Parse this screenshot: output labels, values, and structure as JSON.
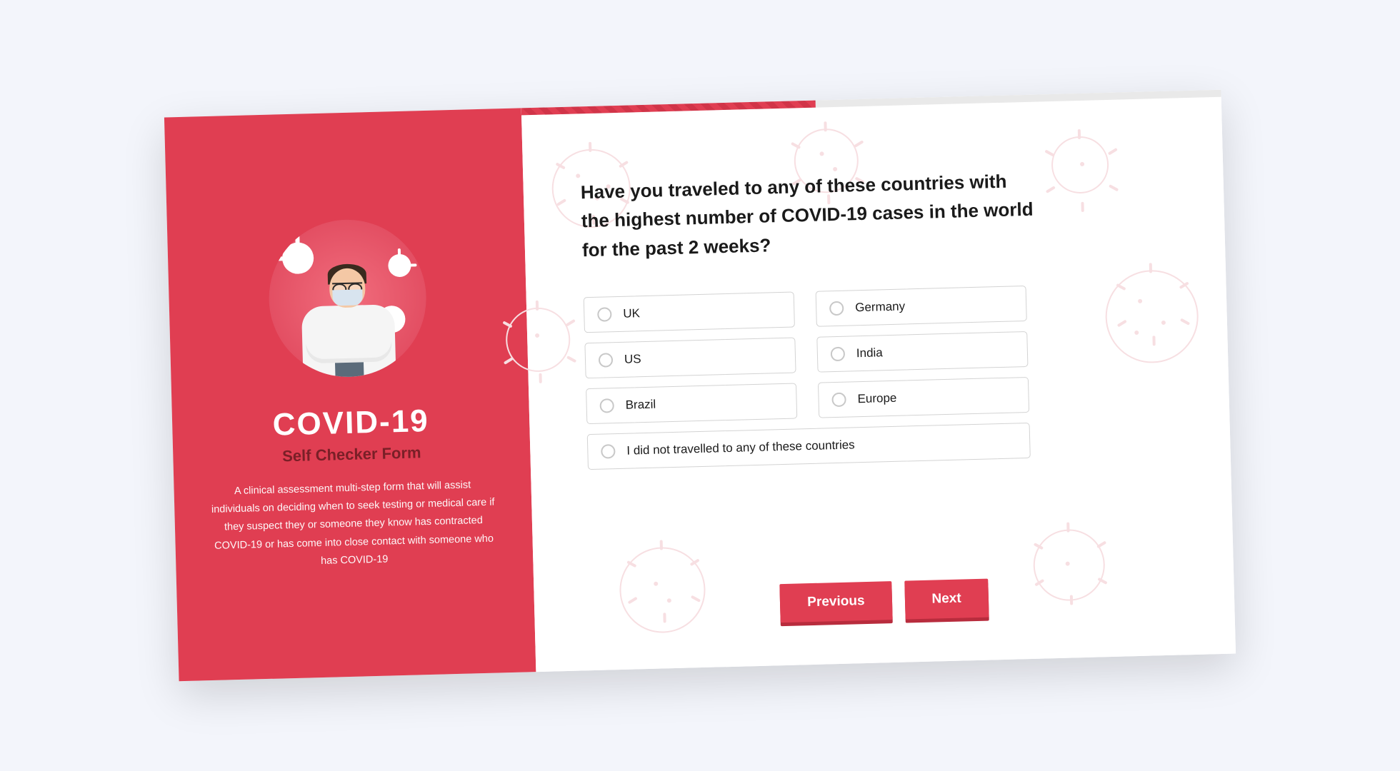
{
  "sidebar": {
    "title": "COVID-19",
    "subtitle": "Self Checker Form",
    "description": "A clinical assessment multi-step form that will assist individuals on deciding when to seek testing or medical care if they suspect they or someone they know has contracted COVID-19 or has come into close contact with someone who has COVID-19"
  },
  "form": {
    "question": "Have you traveled to any of these countries with the highest number of COVID-19 cases in the world for the past 2 weeks?",
    "options": [
      {
        "label": "UK"
      },
      {
        "label": "Germany"
      },
      {
        "label": "US"
      },
      {
        "label": "India"
      },
      {
        "label": "Brazil"
      },
      {
        "label": "Europe"
      },
      {
        "label": "I did not travelled to any of these countries"
      }
    ],
    "nav": {
      "previous": "Previous",
      "next": "Next"
    }
  },
  "colors": {
    "primary": "#e03e52",
    "primaryDark": "#b82c3d"
  }
}
